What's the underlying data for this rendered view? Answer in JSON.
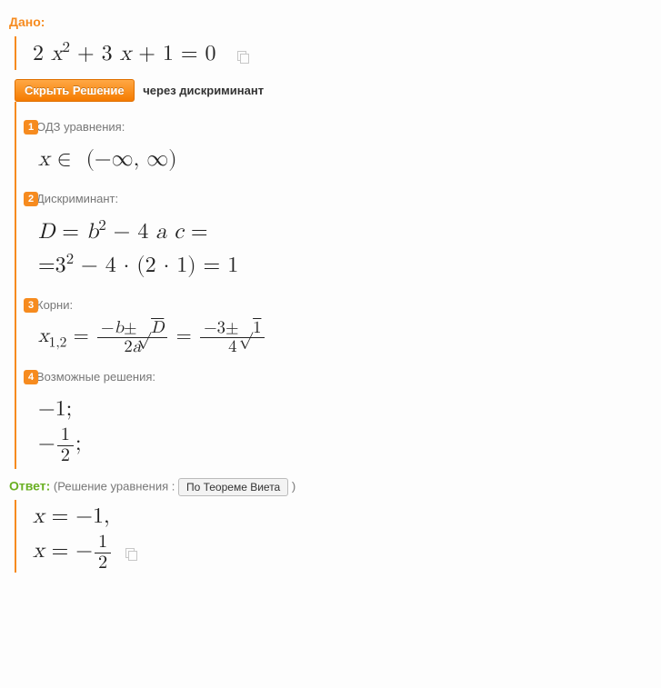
{
  "given": {
    "title": "Дано:",
    "equation_html": "2 <i>x</i><sup>2</sup> + 3 <i>x</i> + 1 = 0"
  },
  "solution": {
    "hide_button": "Скрыть Решение",
    "method": "через дискриминант",
    "steps": [
      {
        "num": "1",
        "label": "ОДЗ уравнения:",
        "formula_html": "<i>x</i> ∈ &nbsp;(−∞, ∞)"
      },
      {
        "num": "2",
        "label": "Дискриминант:",
        "formula_html": "<i>D</i> = <i>b</i><sup>2</sup> − 4 <i>a c</i> =<br>=3<sup>2</sup> − 4 · (2 · 1) = 1"
      },
      {
        "num": "3",
        "label": "Корни:",
        "formula_html": "<i>x</i><sub>1,2</sub> = <span class=\"frac\"><span class=\"top\">−<i>b</i>±√<span style=\"text-decoration:overline\"><i>D</i></span></span><span class=\"bot\">2<i>a</i></span></span> = <span class=\"frac\"><span class=\"top\">−3±√<span style=\"text-decoration:overline\">1</span></span><span class=\"bot\">4</span></span>"
      },
      {
        "num": "4",
        "label": "Возможные решения:",
        "formula_html": "−1;<br>−<span class=\"frac\"><span class=\"top\">1</span><span class=\"bot\">2</span></span>;"
      }
    ]
  },
  "answer": {
    "title": "Ответ:",
    "hint_prefix": "(Решение уравнения : ",
    "vieta_button": "По Теореме Виета",
    "hint_suffix": " )",
    "results_html": "<i>x</i> = −1,<br><i>x</i> = −<span class=\"frac\"><span class=\"top\">1</span><span class=\"bot\">2</span></span>"
  }
}
